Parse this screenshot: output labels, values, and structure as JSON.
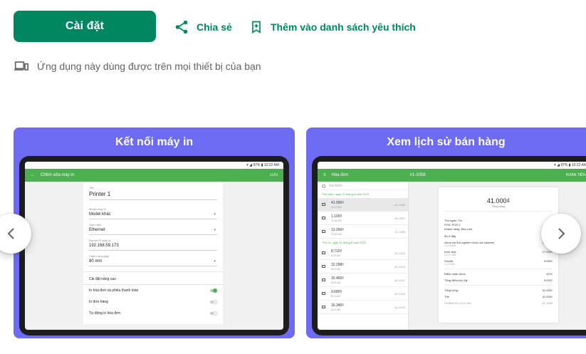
{
  "actions": {
    "install_label": "Cài đặt",
    "share_label": "Chia sẻ",
    "wishlist_label": "Thêm vào danh sách yêu thích"
  },
  "device_note": "Ứng dụng này dùng được trên mọi thiết bị của bạn",
  "colors": {
    "primary": "#01875f",
    "card_bg": "#6d6bf2",
    "app_bar": "#4caf50"
  },
  "screenshots": [
    {
      "title": "Kết nối máy in",
      "app_bar_title": "Chỉnh sửa máy in",
      "app_bar_action": "LƯU",
      "status_text": "▾ ◢ 97% ▮ 10:22 AM",
      "fields": [
        {
          "label": "Tên",
          "value": "Printer 1"
        },
        {
          "label": "Model máy in",
          "value": "Model khác"
        },
        {
          "label": "Giao diện",
          "value": "Ethernet"
        },
        {
          "label": "Địa chỉ IP máy in",
          "value": "192.168.59.173"
        },
        {
          "label": "Chiều rộng giấy",
          "value": "80 mm"
        }
      ],
      "advanced": "Cài đặt nâng cao",
      "options": [
        {
          "label": "In hóa đơn và phiếu thanh toán",
          "on": true
        },
        {
          "label": "In đơn hàng",
          "on": false
        },
        {
          "label": "Tự động in hóa đơn",
          "on": false
        }
      ]
    },
    {
      "title": "Xem lịch sử bán hàng",
      "app_bar_title": "Hóa đơn",
      "app_bar_center": "#1-1058",
      "app_bar_action": "HOÀN TIỀN",
      "status_text": "▾ ◢ 97% ▮ 10:22 AM",
      "search_placeholder": "Tìm kiếm",
      "groups": [
        {
          "label": "Thứ năm, ngày 22 tháng 6 năm 2023",
          "rows": [
            {
              "amount": "41.000₫",
              "time": "11:47 AM",
              "no": "#1-1058"
            },
            {
              "amount": "1.100₫",
              "time": "11:46 AM",
              "no": "#1-1057"
            },
            {
              "amount": "13.266₫",
              "time": "11:45 AM",
              "no": "#1-1056"
            }
          ]
        },
        {
          "label": "Thứ tư, ngày 21 tháng 6 năm 2023",
          "rows": [
            {
              "amount": "8.710₫",
              "time": "8:23 AM",
              "no": "#2-1019"
            },
            {
              "amount": "12.298₫",
              "time": "8:19 AM",
              "no": "#2-1018"
            },
            {
              "amount": "15.460₫",
              "time": "8:15 AM",
              "no": "#2-1017"
            },
            {
              "amount": "9.680₫",
              "time": "8:13 AM",
              "no": "#2-1016"
            },
            {
              "amount": "16.340₫",
              "time": "8:10 AM",
              "no": "#2-1015"
            }
          ]
        }
      ],
      "detail": {
        "total": "41.000₫",
        "total_label": "Tổng cộng",
        "cashier": "Thu ngân: Tín",
        "pos": "POS: POS 2",
        "customer": "Khách hàng: Bảo Linh",
        "dining": "Ăn ở đây",
        "items": [
          {
            "name": "chuối với thử nghiệm nước sốt caramel",
            "qty": "1 x 15.000",
            "price": "15.000₫"
          },
          {
            "name": "Kem dừa",
            "qty": "1 x 17.000",
            "price": "17.000₫"
          },
          {
            "name": "Sôcôla",
            "qty": "1 x 9.000",
            "price": "9.000₫"
          }
        ],
        "points_earned_label": "Điểm nhận được",
        "points_earned": "410₫",
        "points_total_label": "Tổng điểm tích lũy",
        "points_total": "5.092₫",
        "sum_label": "Tổng cộng",
        "sum_value": "41.000₫",
        "card_label": "Thẻ",
        "card_value": "41.000₫",
        "footer_date": "22/06/2023 11:47 AM",
        "footer_no": "#1-1058"
      }
    }
  ],
  "icons": {
    "share": "share-icon",
    "wishlist": "bookmark-add-icon",
    "devices": "devices-icon",
    "prev": "chevron-left-icon",
    "next": "chevron-right-icon"
  }
}
